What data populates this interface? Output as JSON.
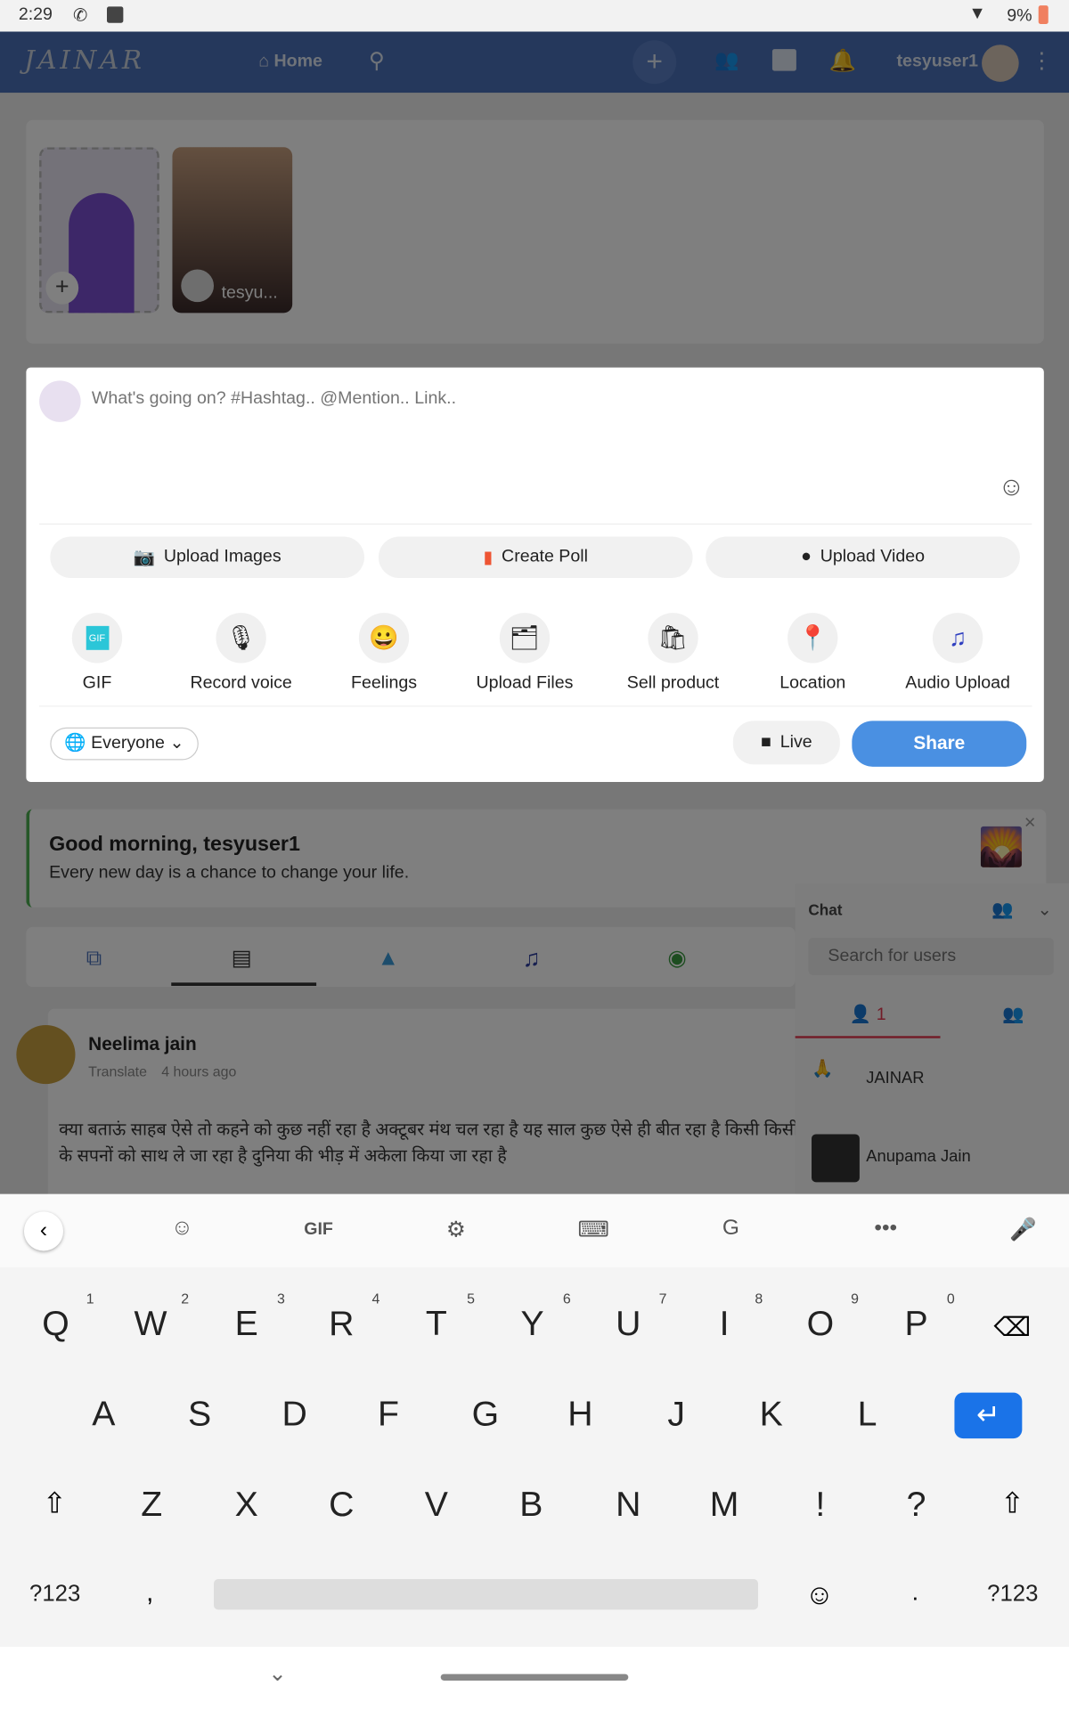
{
  "status": {
    "time": "2:29",
    "battery": "9%"
  },
  "header": {
    "logo": "JAINAR",
    "home": "Home",
    "username": "tesyuser1"
  },
  "stories": {
    "own_label": "+",
    "story_user": "tesyu..."
  },
  "composer": {
    "placeholder": "What's going on? #Hashtag.. @Mention.. Link..",
    "buttons": [
      {
        "label": "Upload Images",
        "icon": "camera-icon"
      },
      {
        "label": "Create Poll",
        "icon": "bar-chart-icon"
      },
      {
        "label": "Upload Video",
        "icon": "video-icon"
      }
    ],
    "actions": [
      {
        "label": "GIF",
        "icon": "gif-icon"
      },
      {
        "label": "Record voice",
        "icon": "microphone-icon"
      },
      {
        "label": "Feelings",
        "icon": "smiley-icon"
      },
      {
        "label": "Upload Files",
        "icon": "file-icon"
      },
      {
        "label": "Sell product",
        "icon": "product-icon"
      },
      {
        "label": "Location",
        "icon": "location-icon"
      },
      {
        "label": "Audio Upload",
        "icon": "music-icon"
      }
    ],
    "privacy": "Everyone",
    "live": "Live",
    "share": "Share"
  },
  "greeting": {
    "title": "Good morning, tesyuser1",
    "text": "Every new day is a chance to change your life."
  },
  "post": {
    "author": "Neelima jain",
    "translate": "Translate",
    "time": "4 hours ago",
    "text": "क्या बताऊं साहब ऐसे तो कहने को कुछ नहीं रहा है अक्टूबर मंथ चल रहा है यह साल कुछ ऐसे ही बीत रहा है किसी किसी के सपनों को साथ ले जा रहा है दुनिया की भीड़ में अकेला किया जा रहा है"
  },
  "chat": {
    "title": "Chat",
    "search_placeholder": "Search for users",
    "online_count": "1",
    "users": [
      "JAINAR",
      "Anupama Jain"
    ]
  },
  "keyboard": {
    "gif": "GIF",
    "row1": [
      "Q",
      "W",
      "E",
      "R",
      "T",
      "Y",
      "U",
      "I",
      "O",
      "P"
    ],
    "row1_nums": [
      "1",
      "2",
      "3",
      "4",
      "5",
      "6",
      "7",
      "8",
      "9",
      "0"
    ],
    "row2": [
      "A",
      "S",
      "D",
      "F",
      "G",
      "H",
      "J",
      "K",
      "L"
    ],
    "row3": [
      "Z",
      "X",
      "C",
      "V",
      "B",
      "N",
      "M",
      "!",
      "?"
    ],
    "sym": "?123",
    "comma": ",",
    "period": "."
  },
  "colors": {
    "header": "#4a70b8",
    "share": "#4a90e2",
    "enter": "#1a73e8",
    "chat_active": "#e53950"
  }
}
